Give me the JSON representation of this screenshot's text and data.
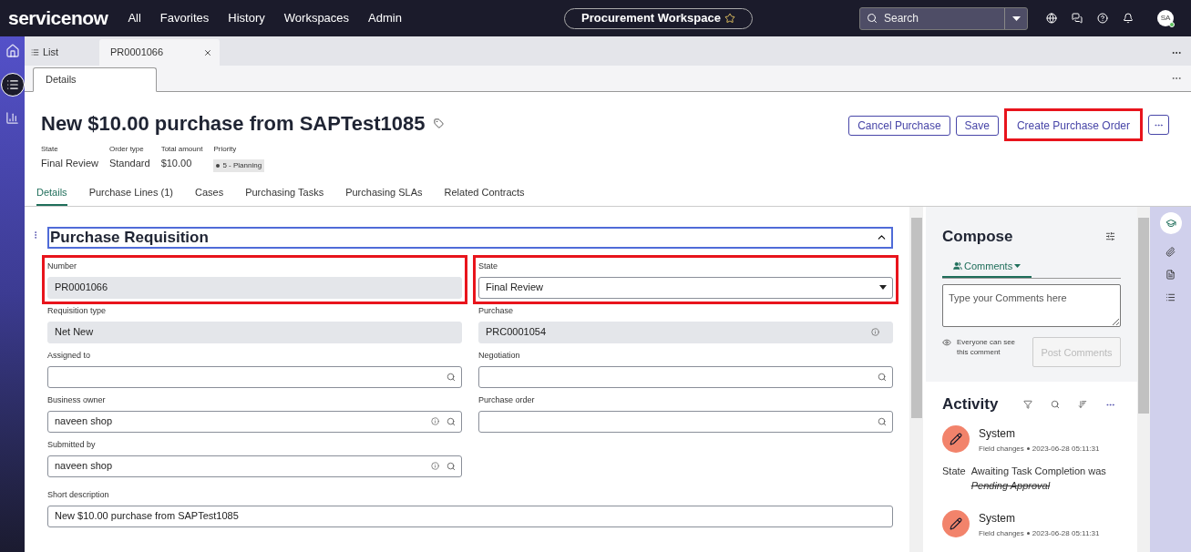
{
  "nav": {
    "logo": "servicenow",
    "items": [
      "All",
      "Favorites",
      "History",
      "Workspaces",
      "Admin"
    ],
    "workspace": "Procurement Workspace",
    "search_placeholder": "Search",
    "avatar": "SA"
  },
  "tabs": [
    {
      "label": "List",
      "kind": "list",
      "selected": false
    },
    {
      "label": "PR0001066",
      "kind": "record",
      "selected": true
    }
  ],
  "subtabs": [
    {
      "label": "Details",
      "selected": true
    }
  ],
  "record": {
    "title": "New $10.00 purchase from SAPTest1085",
    "meta": [
      {
        "label": "State",
        "value": "Final Review",
        "kind": "text"
      },
      {
        "label": "Order type",
        "value": "Standard",
        "kind": "text"
      },
      {
        "label": "Total amount",
        "value": "$10.00",
        "kind": "text"
      },
      {
        "label": "Priority",
        "value": "5 - Planning",
        "kind": "pill"
      }
    ],
    "actions": [
      {
        "label": "Cancel Purchase",
        "highlighted": false
      },
      {
        "label": "Save",
        "highlighted": false
      },
      {
        "label": "Create Purchase Order",
        "highlighted": true
      }
    ]
  },
  "record_tabs": [
    {
      "label": "Details",
      "selected": true
    },
    {
      "label": "Purchase Lines (1)",
      "selected": false
    },
    {
      "label": "Cases",
      "selected": false
    },
    {
      "label": "Purchasing Tasks",
      "selected": false
    },
    {
      "label": "Purchasing SLAs",
      "selected": false
    },
    {
      "label": "Related Contracts",
      "selected": false
    }
  ],
  "section": {
    "title": "Purchase Requisition",
    "expanded": true
  },
  "rows": [
    [
      {
        "label": "Number",
        "value": "PR0001066",
        "kind": "readonly",
        "info": false,
        "highlighted": true
      },
      {
        "label": "State",
        "value": "Final Review",
        "kind": "select",
        "info": false,
        "highlighted": true
      }
    ],
    [
      {
        "label": "Requisition type",
        "value": "Net New",
        "kind": "readonly",
        "info": false
      },
      {
        "label": "Purchase",
        "value": "PRC0001054",
        "kind": "readonly",
        "info": true
      }
    ],
    [
      {
        "label": "Assigned to",
        "kind": "reference",
        "info": false
      },
      {
        "label": "Negotiation",
        "kind": "reference",
        "info": false
      }
    ],
    [
      {
        "label": "Business owner",
        "value": "naveen shop",
        "kind": "reference",
        "info": true
      },
      {
        "label": "Purchase order",
        "kind": "reference",
        "info": false
      }
    ],
    [
      {
        "label": "Submitted by",
        "value": "naveen shop",
        "kind": "reference",
        "info": true
      }
    ],
    [
      {
        "label": "Short description",
        "value": "New $10.00 purchase from SAPTest1085",
        "kind": "text",
        "info": false,
        "wide": true
      }
    ]
  ],
  "compose": {
    "title": "Compose",
    "tab": "Comments",
    "placeholder": "Type your Comments here",
    "visibility": "Everyone can see this comment",
    "post": {
      "label": "Post Comments",
      "disabled": true
    }
  },
  "activity": {
    "title": "Activity",
    "entries": [
      {
        "author": "System",
        "type": "Field changes",
        "time": "2023-06-28 05:11:31",
        "changes": [
          {
            "field": "State",
            "value": "Awaiting Task Completion was",
            "old": "Pending Approval"
          }
        ]
      },
      {
        "author": "System",
        "type": "Field changes",
        "time": "2023-06-28 05:11:31"
      }
    ]
  }
}
